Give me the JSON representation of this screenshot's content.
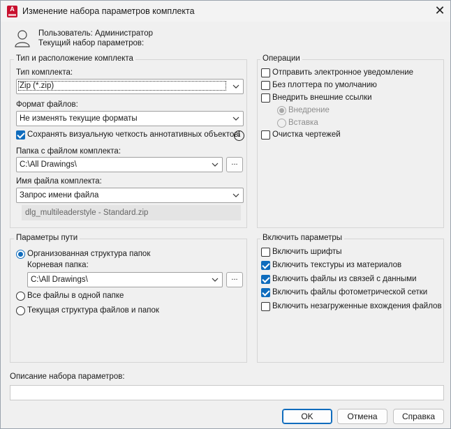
{
  "window": {
    "title": "Изменение набора параметров комплекта",
    "app_icon_letter": "A"
  },
  "header": {
    "user_label": "Пользователь: Администратор",
    "current_set_label": "Текущий набор параметров:"
  },
  "package_type_group": {
    "title": "Тип и расположение комплекта",
    "package_type_label": "Тип комплекта:",
    "package_type_value": "Zip (*.zip)",
    "file_format_label": "Формат файлов:",
    "file_format_value": "Не изменять текущие форматы",
    "keep_annotative_label": "Сохранять визуальную четкость аннотативных объектов",
    "keep_annotative_checked": true,
    "folder_label": "Папка с файлом комплекта:",
    "folder_value": "C:\\All Drawings\\",
    "browse_label": "...",
    "file_name_label": "Имя файла комплекта:",
    "file_name_value": "Запрос имени файла",
    "file_name_preview": "dlg_multileaderstyle - Standard.zip"
  },
  "operations_group": {
    "title": "Операции",
    "send_email": "Отправить электронное уведомление",
    "no_plotter": "Без плоттера по умолчанию",
    "bind_xrefs": "Внедрить внешние ссылки",
    "bind_option": "Внедрение",
    "insert_option": "Вставка",
    "purge_drawings": "Очистка чертежей"
  },
  "path_group": {
    "title": "Параметры пути",
    "organized_label": "Организованная структура папок",
    "root_folder_label": "Корневая папка:",
    "root_folder_value": "C:\\All Drawings\\",
    "browse_label": "...",
    "single_folder_label": "Все файлы в одной папке",
    "keep_structure_label": "Текущая структура файлов и папок"
  },
  "include_group": {
    "title": "Включить параметры",
    "include_fonts": "Включить шрифты",
    "include_textures": "Включить текстуры из материалов",
    "include_data_links": "Включить файлы из связей с данными",
    "include_photometric": "Включить файлы фотометрической сетки",
    "include_unloaded": "Включить незагруженные вхождения файлов"
  },
  "description": {
    "label": "Описание набора параметров:",
    "value": ""
  },
  "footer": {
    "ok_label": "OK",
    "cancel_label": "Отмена",
    "help_label": "Справка"
  },
  "colors": {
    "accent": "#0f6cbd",
    "app_icon": "#c8102e"
  }
}
